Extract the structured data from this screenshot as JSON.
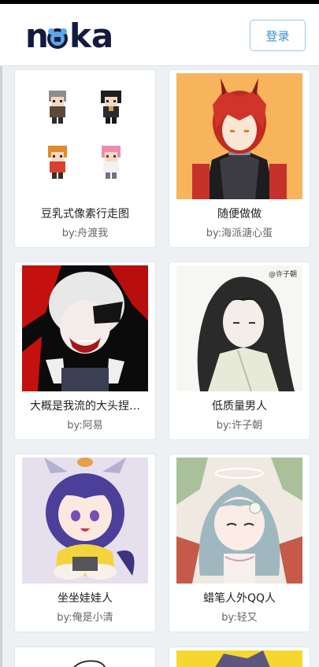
{
  "header": {
    "logo_text": "noka",
    "login_label": "登录"
  },
  "cards": [
    {
      "title": "豆乳式像素行走图",
      "author": "by:舟渡我"
    },
    {
      "title": "随便做做",
      "author": "by:海派溏心蛋"
    },
    {
      "title": "大概是我流的大头捏…",
      "author": "by:阿易"
    },
    {
      "title": "低质量男人",
      "author": "by:许子朝",
      "signature": "@许子朝"
    },
    {
      "title": "坐坐娃娃人",
      "author": "by:俺是小清"
    },
    {
      "title": "蜡笔人外QQ人",
      "author": "by:轻又"
    }
  ],
  "colors": {
    "accent": "#3a8fd1",
    "logo": "#141a3d",
    "page_bg": "#eef1f4"
  }
}
